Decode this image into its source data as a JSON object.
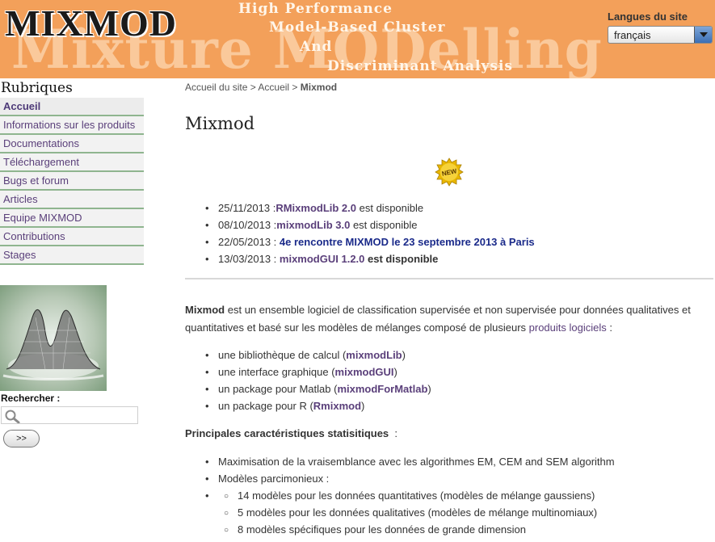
{
  "banner": {
    "logo": "MIXMOD",
    "watermark": "Mixture MODelling",
    "taglines": [
      "High Performance",
      "Model-Based Cluster",
      "And",
      "Discriminant Analysis"
    ]
  },
  "language": {
    "title": "Langues du site",
    "selected": "français"
  },
  "sidebar": {
    "title": "Rubriques",
    "items": [
      {
        "label": "Accueil"
      },
      {
        "label": "Informations sur les produits"
      },
      {
        "label": "Documentations"
      },
      {
        "label": "Téléchargement"
      },
      {
        "label": "Bugs et forum"
      },
      {
        "label": "Articles"
      },
      {
        "label": "Equipe MIXMOD"
      },
      {
        "label": "Contributions"
      },
      {
        "label": "Stages"
      }
    ],
    "search_label": "Rechercher :",
    "search_button": ">>"
  },
  "breadcrumb": {
    "items": [
      "Accueil du site",
      " > ",
      "Accueil",
      " > "
    ],
    "current": "Mixmod"
  },
  "main": {
    "title": "Mixmod",
    "new_badge": "NEW",
    "news": [
      {
        "date": "25/11/2013 :",
        "link": "RMixmodLib 2.0",
        "rest": " est disponible"
      },
      {
        "date": "08/10/2013 :",
        "link": "mixmodLib 3.0",
        "rest": " est disponible"
      },
      {
        "date": "22/05/2013 : ",
        "link": "4e rencontre MIXMOD le 23 septembre 2013 à Paris",
        "rest": ""
      },
      {
        "date": "13/03/2013 : ",
        "link": "mixmodGUI 1.2.0",
        "rest": " est disponible"
      }
    ],
    "intro": {
      "kw": "Mixmod",
      "text": " est un ensemble logiciel de classification supervisée et non supervisée pour données qualitatives et quantitatives et basé sur les modèles de mélanges composé de plusieurs ",
      "link": "produits logiciels",
      "tail": " :"
    },
    "products": [
      {
        "pre": "une bibliothèque de calcul (",
        "link": "mixmodLib",
        "post": ")"
      },
      {
        "pre": "une interface graphique (",
        "link": "mixmodGUI",
        "post": ")"
      },
      {
        "pre": "un package pour Matlab (",
        "link": "mixmodForMatlab",
        "post": ")"
      },
      {
        "pre": "un package pour R (",
        "link": "Rmixmod",
        "post": ")"
      }
    ],
    "section_title": "Principales caractéristiques statisitiques",
    "section_colon": "  :",
    "characteristics": [
      "Maximisation de la vraisemblance avec les algorithmes EM, CEM and SEM algorithm",
      "Modèles parcimonieux :"
    ],
    "sub_characteristics": [
      "14 modèles pour les données quantitatives (modèles de mélange gaussiens)",
      "5 modèles pour les données qualitatives (modèles de mélange multinomiaux)",
      "8 modèles spécifiques pour les données de grande dimension"
    ]
  },
  "colors": {
    "banner": "#f3a05a",
    "link": "#5a3f7a",
    "link_blue": "#1a2a8a",
    "menu_border": "#8fb58f"
  }
}
